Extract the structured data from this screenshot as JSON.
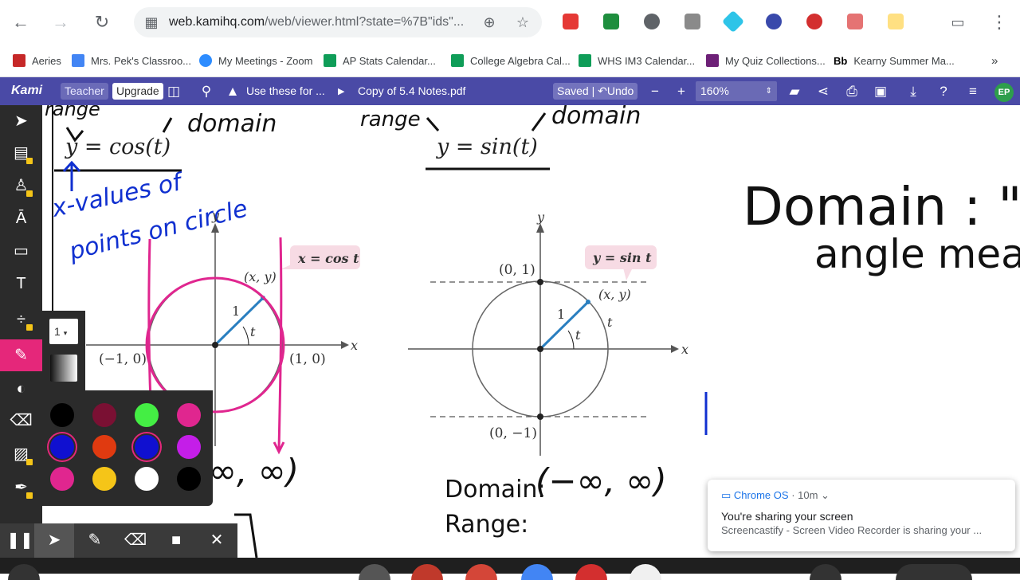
{
  "browser": {
    "url_main": "web.kamihq.com",
    "url_rest": "/web/viewer.html?state=%7B\"ids\"...",
    "bookmarks": [
      {
        "label": "Aeries",
        "color": "#c62828"
      },
      {
        "label": "Mrs. Pek's Classroo...",
        "color": "#4285f4"
      },
      {
        "label": "My Meetings - Zoom",
        "color": "#2d8cff"
      },
      {
        "label": "AP Stats Calendar...",
        "color": "#0f9d58"
      },
      {
        "label": "College Algebra Cal...",
        "color": "#0f9d58"
      },
      {
        "label": "WHS IM3 Calendar...",
        "color": "#0f9d58"
      },
      {
        "label": "My Quiz Collections...",
        "color": "#6d2077"
      },
      {
        "label": "Kearny Summer Ma...",
        "color": "#000000"
      }
    ],
    "bookmark_bb": "Bb",
    "more_label": "»"
  },
  "kami": {
    "logo": "Kami",
    "teacher": "Teacher",
    "upgrade": "Upgrade",
    "folder_title": "Use these for ...",
    "doc_title": "Copy of 5.4 Notes.pdf",
    "saved": "Saved",
    "undo": "Undo",
    "zoom": "160%",
    "avatar": "EP"
  },
  "palette": {
    "size": "1",
    "colors": [
      "#000000",
      "#7a1033",
      "#44ee44",
      "#e0268f",
      "#1010d0",
      "#e03a10",
      "#1010d0",
      "#c41ee8",
      "#e0268f",
      "#f5c518",
      "#ffffff",
      "#000000"
    ]
  },
  "doc": {
    "eq_cos": "y = cos(t)",
    "eq_sin": "y = sin(t)",
    "hw_domain1": "domain",
    "hw_range1": "range",
    "hw_domain2": "domain",
    "hw_range2": "range",
    "hw_xvalues": "x-values of",
    "hw_points": "points on circle",
    "hw_big_domain": "Domain : \"t\",",
    "hw_angle": "angle meas",
    "bubble_cos": "x = cos t",
    "bubble_sin": "y = sin t",
    "left_graph": {
      "pt_xy": "(x, y)",
      "neg": "(−1, 0)",
      "pos": "(1, 0)",
      "r": "1",
      "t": "t",
      "x_axis": "x",
      "y_axis": "y"
    },
    "right_graph": {
      "top": "(0, 1)",
      "bottom": "(0, −1)",
      "pt_xy": "(x, y)",
      "r": "1",
      "t": "t",
      "t2": "t",
      "x_axis": "x",
      "y_axis": "y"
    },
    "printed_domain": "Domain:",
    "printed_range": "Range:",
    "hw_domain_value": "(−∞, ∞)",
    "hw_left_value": "∞, ∞)"
  },
  "notification": {
    "source": "Chrome OS",
    "time": "· 10m",
    "title": "You're sharing your screen",
    "body": "Screencastify - Screen Video Recorder is sharing your ..."
  }
}
